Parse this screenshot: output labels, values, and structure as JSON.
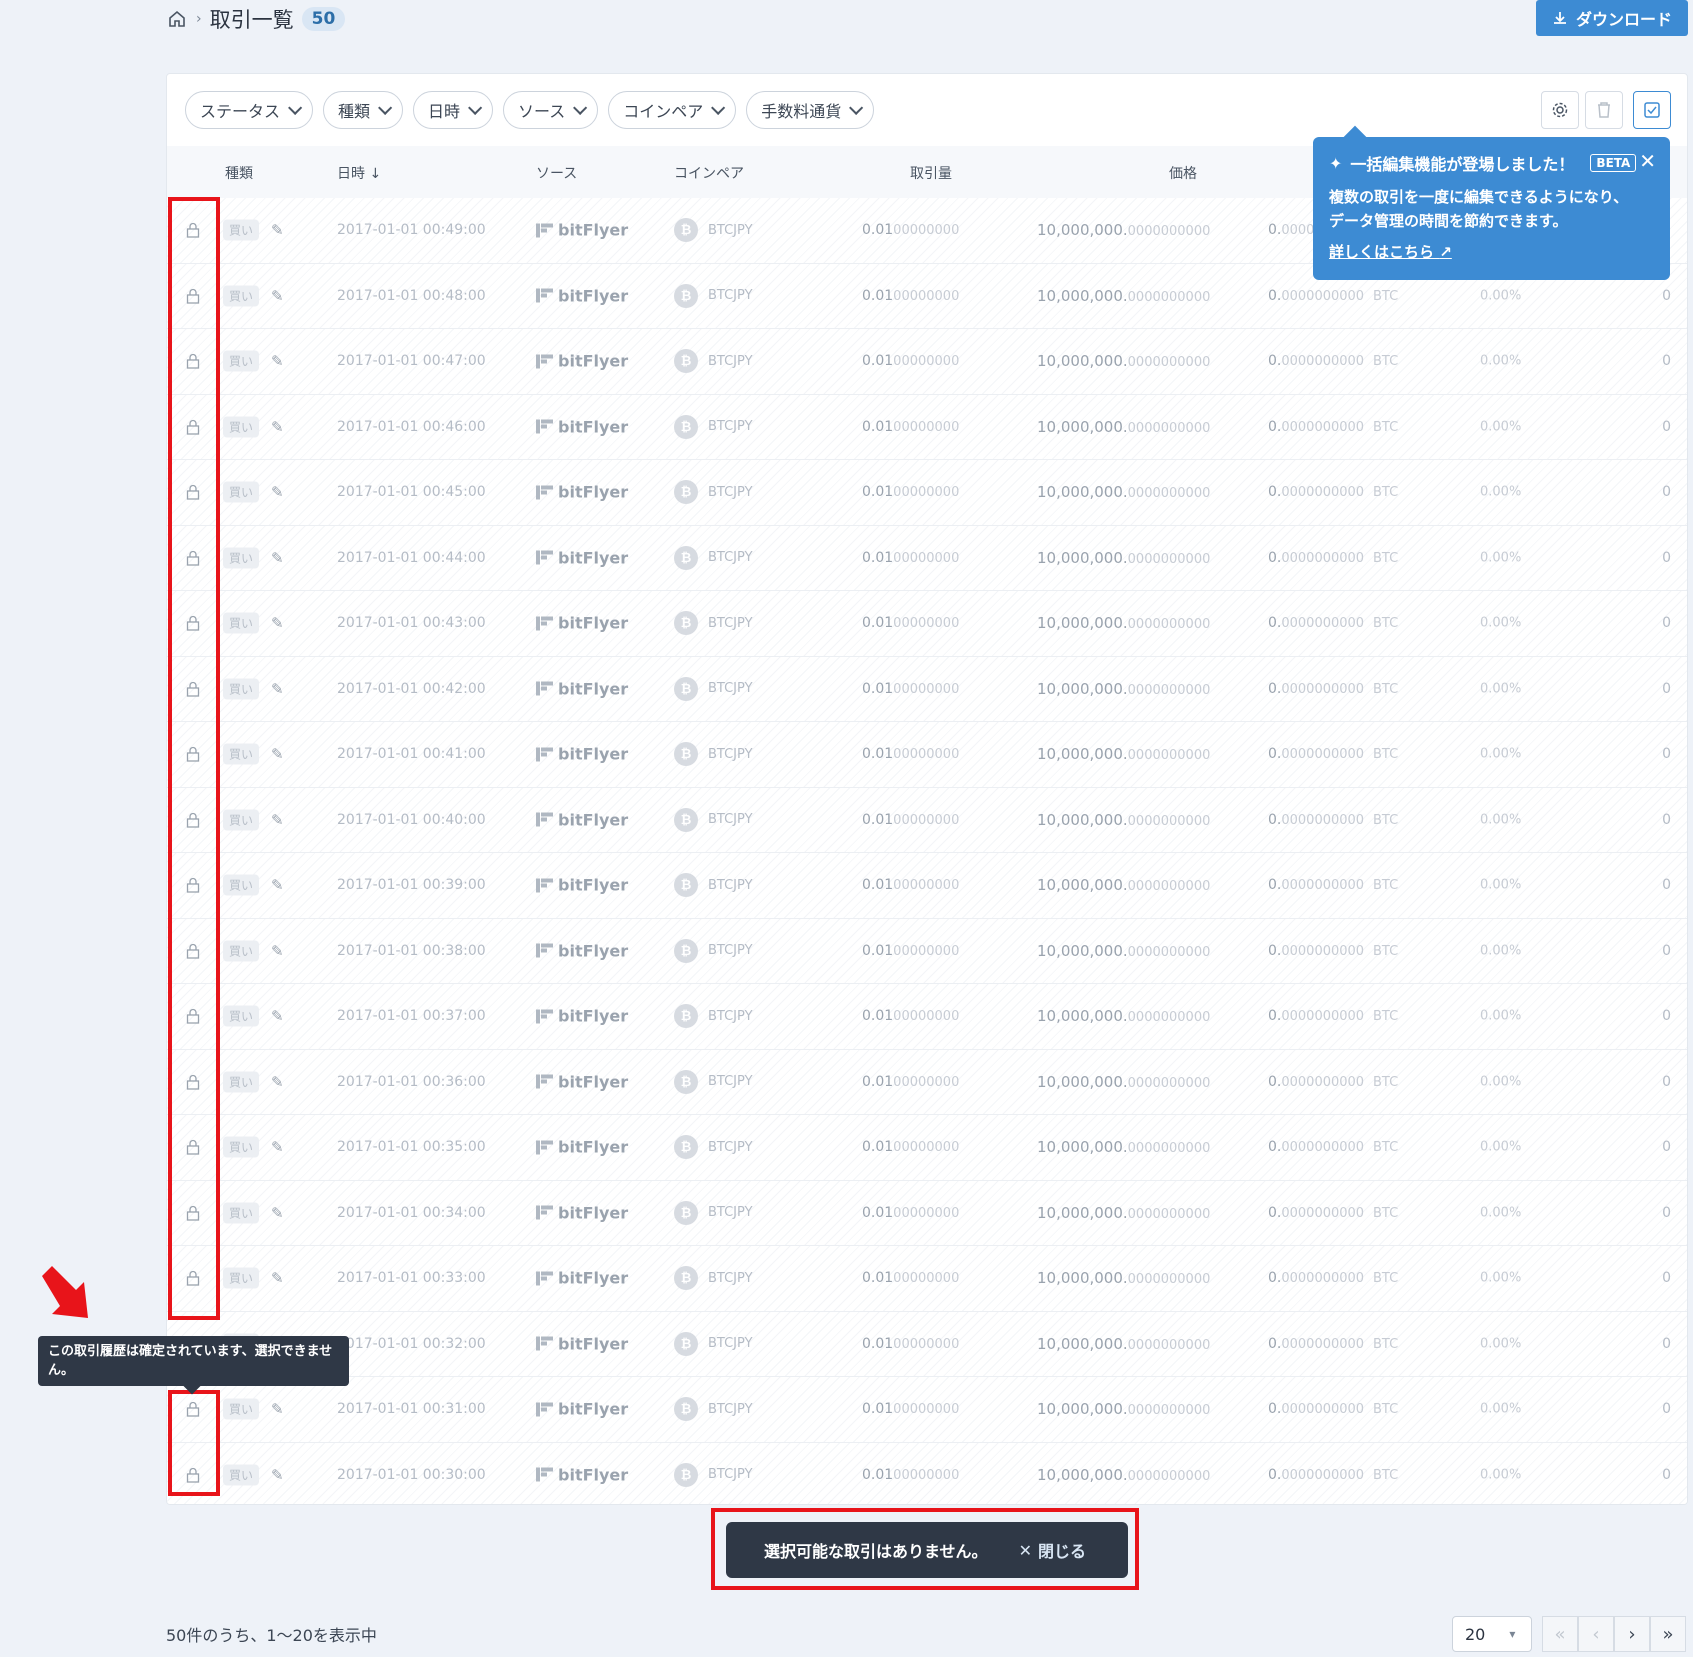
{
  "header": {
    "title": "取引一覧",
    "count": "50",
    "download_label": "ダウンロード"
  },
  "filters": [
    "ステータス",
    "種類",
    "日時",
    "ソース",
    "コインペア",
    "手数料通貨"
  ],
  "columns": {
    "type": "種類",
    "date": "日時 ↓",
    "source": "ソース",
    "coinpair": "コインペア",
    "amount": "取引量",
    "price": "価格"
  },
  "rows": [
    {
      "date": "2017-01-01 00:49:00"
    },
    {
      "date": "2017-01-01 00:48:00"
    },
    {
      "date": "2017-01-01 00:47:00"
    },
    {
      "date": "2017-01-01 00:46:00"
    },
    {
      "date": "2017-01-01 00:45:00"
    },
    {
      "date": "2017-01-01 00:44:00"
    },
    {
      "date": "2017-01-01 00:43:00"
    },
    {
      "date": "2017-01-01 00:42:00"
    },
    {
      "date": "2017-01-01 00:41:00"
    },
    {
      "date": "2017-01-01 00:40:00"
    },
    {
      "date": "2017-01-01 00:39:00"
    },
    {
      "date": "2017-01-01 00:38:00"
    },
    {
      "date": "2017-01-01 00:37:00"
    },
    {
      "date": "2017-01-01 00:36:00"
    },
    {
      "date": "2017-01-01 00:35:00"
    },
    {
      "date": "2017-01-01 00:34:00"
    },
    {
      "date": "2017-01-01 00:33:00"
    },
    {
      "date": "2017-01-01 00:32:00"
    },
    {
      "date": "2017-01-01 00:31:00"
    },
    {
      "date": "2017-01-01 00:30:00"
    }
  ],
  "row_common": {
    "type": "買い",
    "source": "bitFlyer",
    "coinpair": "BTCJPY",
    "amount_main": "0.01",
    "amount_tail": "00000000",
    "price_main": "10,000,000.",
    "price_tail": "0000000000",
    "fee_main": "0.",
    "fee_tail": "0000000000",
    "fee_currency": "BTC",
    "fee_pct": "0.00%",
    "last": "0"
  },
  "promo": {
    "title": "一括編集機能が登場しました！",
    "beta": "BETA",
    "body_line1": "複数の取引を一度に編集できるようになり、",
    "body_line2": "データ管理の時間を節約できます。",
    "link": "詳しくはこちら"
  },
  "lock_tooltip": "この取引履歴は確定されています、選択できません。",
  "toast": {
    "message": "選択可能な取引はありません。",
    "close": "閉じる"
  },
  "footer": {
    "summary": "50件のうち、1〜20を表示中",
    "page_size": "20"
  },
  "colors": {
    "accent": "#3d8bd3",
    "annotation": "#e8141a",
    "toast_bg": "#2f3846"
  }
}
